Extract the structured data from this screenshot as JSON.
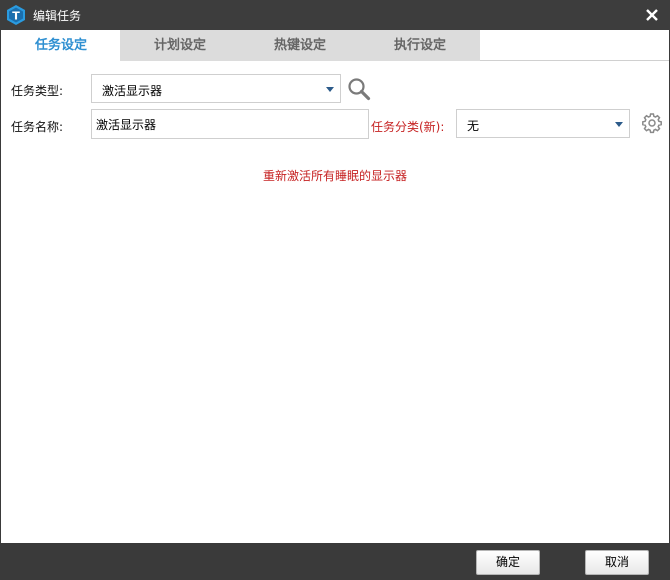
{
  "window": {
    "title": "编辑任务"
  },
  "tabs": [
    {
      "label": "任务设定",
      "active": true
    },
    {
      "label": "计划设定",
      "active": false
    },
    {
      "label": "热键设定",
      "active": false
    },
    {
      "label": "执行设定",
      "active": false
    }
  ],
  "form": {
    "task_type_label": "任务类型:",
    "task_type_value": "激活显示器",
    "task_name_label": "任务名称:",
    "task_name_value": "激活显示器",
    "category_label": "任务分类(新):",
    "category_value": "无"
  },
  "description": "重新激活所有睡眠的显示器",
  "footer": {
    "ok_label": "确定",
    "cancel_label": "取消"
  },
  "icons": {
    "logo": "app-logo-icon",
    "close": "close-icon",
    "search": "search-icon",
    "gear": "gear-icon",
    "dropdown": "chevron-down-icon"
  },
  "colors": {
    "accent": "#2e8fd1",
    "warning_text": "#c62222",
    "titlebar": "#3d3d3d"
  }
}
